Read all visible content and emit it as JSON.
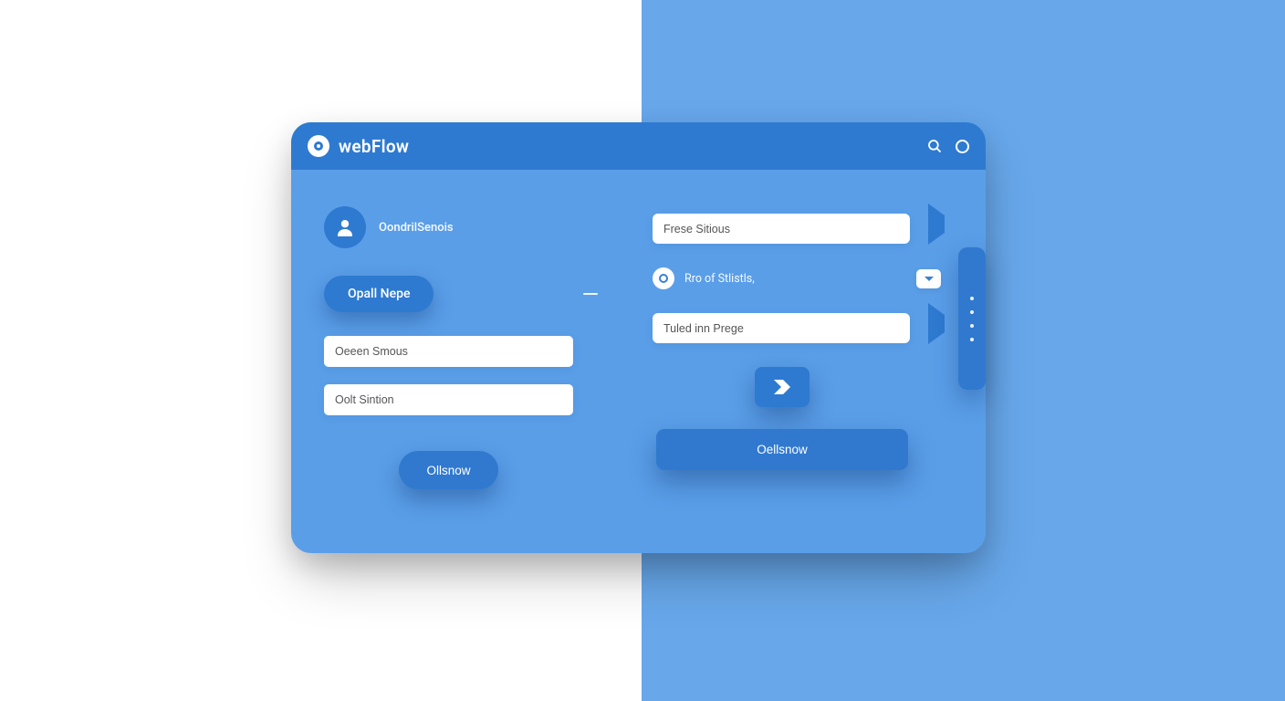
{
  "colors": {
    "panel_blue": "#5a9ee8",
    "header_blue": "#2e7ad1",
    "button_blue": "#3079cf",
    "right_bg": "#67a7ea",
    "left_bg": "#ffffff"
  },
  "header": {
    "brand": "webFlow"
  },
  "left": {
    "avatar_label": "OondrilSenois",
    "chip_label": "Opall Nepe",
    "input1_value": "Oeeen Smous",
    "input2_value": "Oolt Sintion",
    "button_label": "Ollsnow"
  },
  "right": {
    "input1_value": "Frese Sitious",
    "row2_label": "Rro of Stlistls,",
    "input3_value": "Tuled inn Prege",
    "button_label": "Oellsnow"
  }
}
